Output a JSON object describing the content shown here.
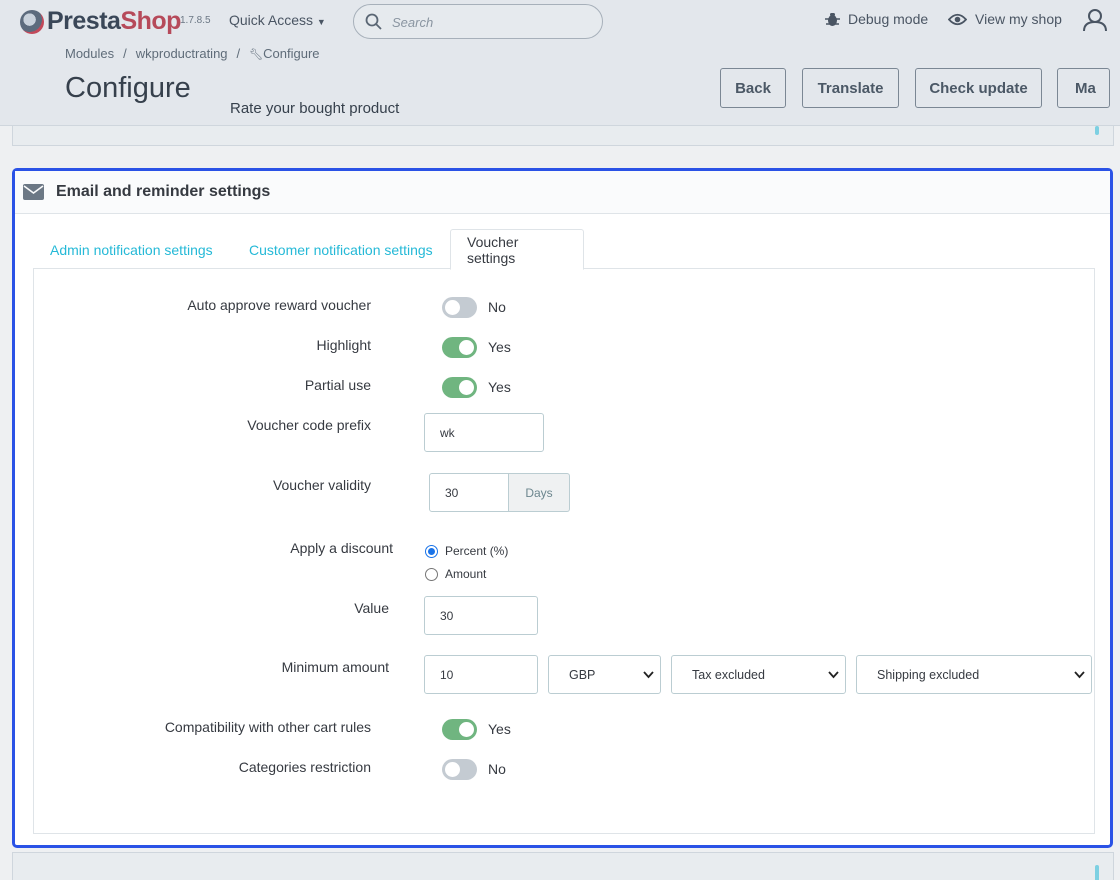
{
  "topbar": {
    "logo_part1": "Presta",
    "logo_part2": "Shop",
    "version": "1.7.8.5",
    "quick_access": "Quick Access",
    "search_placeholder": "Search",
    "debug_mode": "Debug mode",
    "view_shop": "View my shop"
  },
  "header": {
    "breadcrumb": [
      "Modules",
      "wkproductrating",
      "Configure"
    ],
    "title": "Configure",
    "subtitle": "Rate your bought product",
    "buttons": [
      "Back",
      "Translate",
      "Check update",
      "Ma"
    ]
  },
  "panel": {
    "title": "Email and reminder settings",
    "tabs": [
      "Admin notification settings",
      "Customer notification settings",
      "Voucher settings"
    ],
    "active_tab": "Voucher settings"
  },
  "form": {
    "auto_approve": {
      "label": "Auto approve reward voucher",
      "value": "No",
      "on": false
    },
    "highlight": {
      "label": "Highlight",
      "value": "Yes",
      "on": true
    },
    "partial_use": {
      "label": "Partial use",
      "value": "Yes",
      "on": true
    },
    "prefix": {
      "label": "Voucher code prefix",
      "value": "wk"
    },
    "validity": {
      "label": "Voucher validity",
      "value": "30",
      "unit": "Days"
    },
    "discount": {
      "label": "Apply a discount",
      "options": [
        "Percent (%)",
        "Amount"
      ],
      "selected": "Percent (%)"
    },
    "value": {
      "label": "Value",
      "value": "30"
    },
    "minimum": {
      "label": "Minimum amount",
      "value": "10",
      "currency": "GBP",
      "tax": "Tax excluded",
      "shipping": "Shipping excluded"
    },
    "compatibility": {
      "label": "Compatibility with other cart rules",
      "value": "Yes",
      "on": true
    },
    "categories": {
      "label": "Categories restriction",
      "value": "No",
      "on": false
    }
  },
  "colors": {
    "accent": "#25b9d7",
    "switch_on": "#70b580",
    "focus_border": "#2a52e6"
  }
}
